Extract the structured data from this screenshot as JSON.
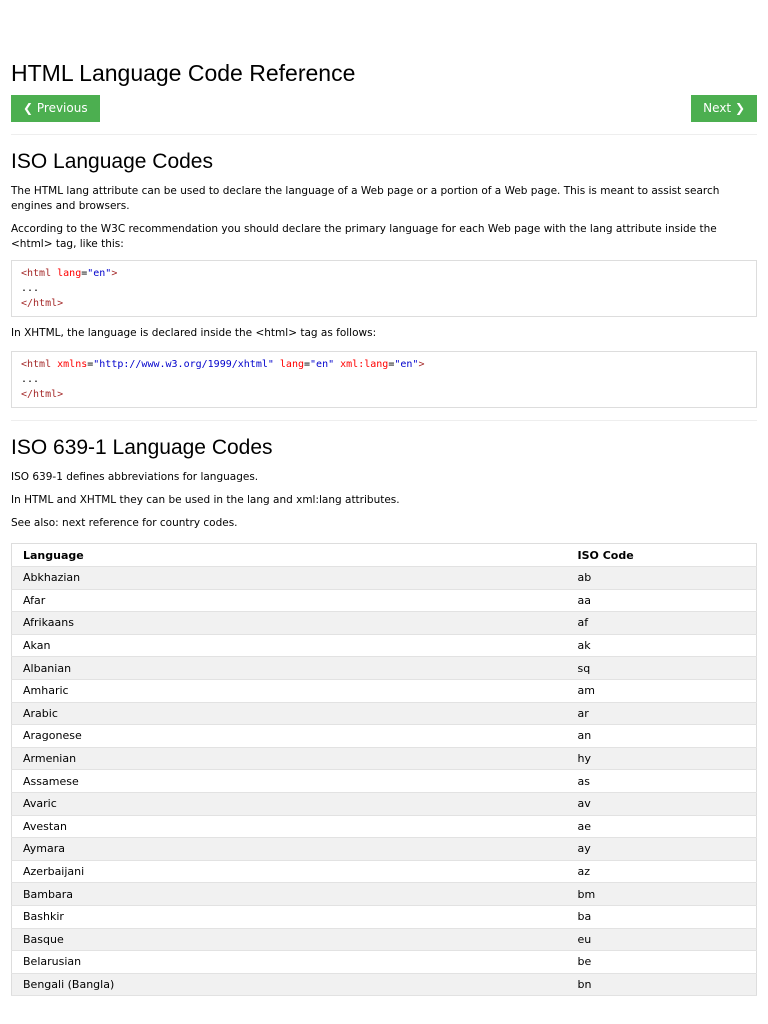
{
  "title": "HTML Language Code Reference",
  "nav": {
    "previous": "❮ Previous",
    "next": "Next ❯"
  },
  "section1": {
    "heading": "ISO Language Codes",
    "p1": "The HTML lang attribute can be used to declare the language of a Web page or a portion of a Web page. This is meant to assist search engines and browsers.",
    "p2": "According to the W3C recommendation you should declare the primary language for each Web page with the lang attribute inside the <html> tag, like this:",
    "code1": {
      "open": "<html",
      "attr": " lang",
      "eq": "=",
      "val": "\"en\"",
      "close": ">",
      "dots": "...",
      "end": "</html>"
    },
    "p3": "In XHTML, the language is declared inside the <html> tag as follows:",
    "code2": {
      "open": "<html",
      "a1": " xmlns",
      "v1": "\"http://www.w3.org/1999/xhtml\"",
      "a2": " lang",
      "v2": "\"en\"",
      "a3": " xml:lang",
      "v3": "\"en\"",
      "eq": "=",
      "close": ">",
      "dots": "...",
      "end": "</html>"
    }
  },
  "section2": {
    "heading": "ISO 639-1 Language Codes",
    "p1": "ISO 639-1 defines abbreviations for languages.",
    "p2": "In HTML and XHTML they can be used in the lang and xml:lang attributes.",
    "p3": "See also: next reference for country codes."
  },
  "table": {
    "headers": [
      "Language",
      "ISO Code"
    ],
    "rows": [
      [
        "Abkhazian",
        "ab"
      ],
      [
        "Afar",
        "aa"
      ],
      [
        "Afrikaans",
        "af"
      ],
      [
        "Akan",
        "ak"
      ],
      [
        "Albanian",
        "sq"
      ],
      [
        "Amharic",
        "am"
      ],
      [
        "Arabic",
        "ar"
      ],
      [
        "Aragonese",
        "an"
      ],
      [
        "Armenian",
        "hy"
      ],
      [
        "Assamese",
        "as"
      ],
      [
        "Avaric",
        "av"
      ],
      [
        "Avestan",
        "ae"
      ],
      [
        "Aymara",
        "ay"
      ],
      [
        "Azerbaijani",
        "az"
      ],
      [
        "Bambara",
        "bm"
      ],
      [
        "Bashkir",
        "ba"
      ],
      [
        "Basque",
        "eu"
      ],
      [
        "Belarusian",
        "be"
      ],
      [
        "Bengali (Bangla)",
        "bn"
      ]
    ]
  }
}
